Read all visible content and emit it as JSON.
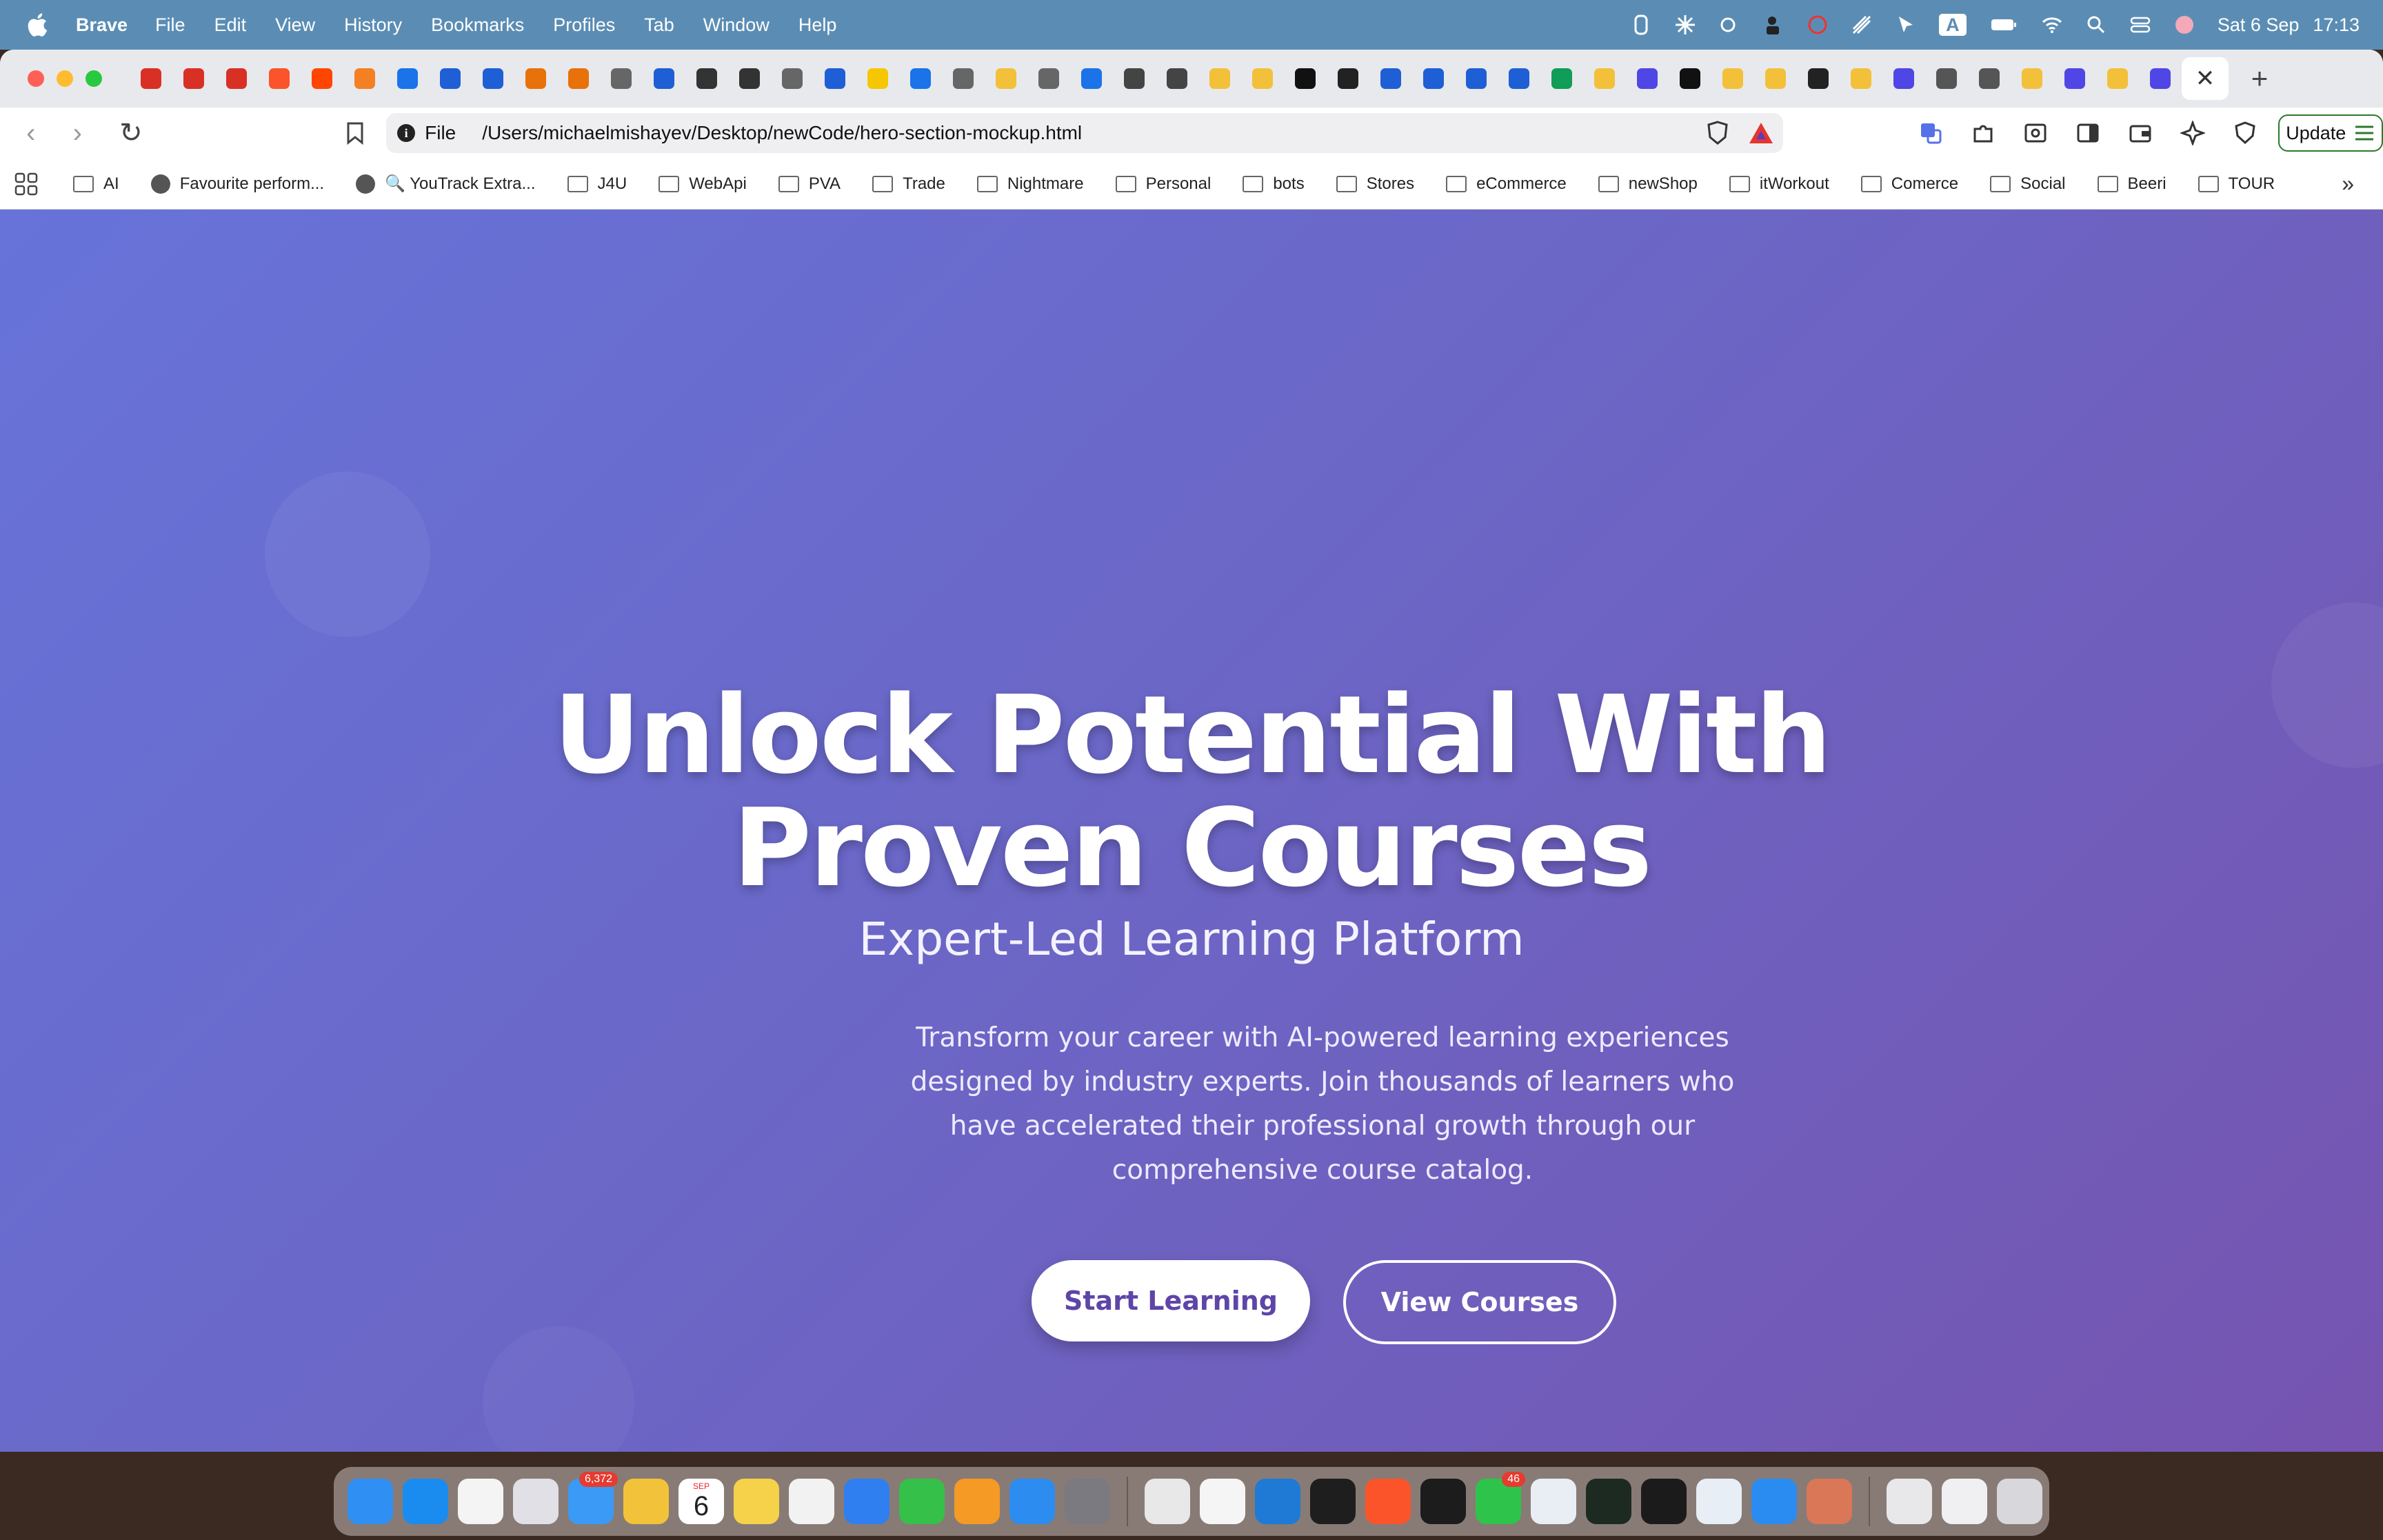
{
  "menubar": {
    "app_name": "Brave",
    "menus": [
      "File",
      "Edit",
      "View",
      "History",
      "Bookmarks",
      "Profiles",
      "Tab",
      "Window",
      "Help"
    ],
    "status_icons": [
      "figma-status-icon",
      "sparkle-status-icon",
      "weather-status-icon",
      "user-lock-icon",
      "blocked-icon",
      "stripes-icon",
      "cursor-icon",
      "input-source-icon",
      "battery-icon",
      "wifi-icon",
      "spotlight-search-icon",
      "control-center-icon",
      "profile-avatar-icon"
    ],
    "input_source": "A",
    "date": "Sat 6 Sep",
    "time": "17:13"
  },
  "tabs": {
    "favicons": [
      "#d93025",
      "#d93025",
      "#d93025",
      "#fb542b",
      "#ff4500",
      "#f48024",
      "#1a73e8",
      "#1f5fd6",
      "#1f5fd6",
      "#e8710a",
      "#e8710a",
      "#666666",
      "#1f5fd6",
      "#333333",
      "#333333",
      "#666666",
      "#1f5fd6",
      "#f6c700",
      "#1a73e8",
      "#666666",
      "#f3c03a",
      "#666666",
      "#1a73e8",
      "#444444",
      "#444444",
      "#f3c03a",
      "#f3c03a",
      "#111111",
      "#222222",
      "#1f5fd6",
      "#1f5fd6",
      "#1f5fd6",
      "#1f5fd6",
      "#0f9d58",
      "#f3c03a",
      "#4f46e5",
      "#111111",
      "#f3c03a",
      "#f3c03a",
      "#222222",
      "#f3c03a",
      "#4f46e5",
      "#555555",
      "#555555",
      "#f3c03a",
      "#4f46e5",
      "#f3c03a",
      "#4f46e5"
    ],
    "close_symbol": "✕",
    "new_tab_symbol": "+"
  },
  "toolbar": {
    "back": "‹",
    "forward": "›",
    "reload": "↻",
    "url_scheme": "File",
    "url": "/Users/michaelmishayev/Desktop/newCode/hero-section-mockup.html",
    "update_label": "Update"
  },
  "bookmarks": [
    {
      "label": "AI",
      "icon": "folder-icon"
    },
    {
      "label": "Favourite perform...",
      "icon": "globe-icon"
    },
    {
      "label": "🔍 YouTrack Extra...",
      "icon": "globe-icon"
    },
    {
      "label": "J4U",
      "icon": "folder-icon"
    },
    {
      "label": "WebApi",
      "icon": "folder-icon"
    },
    {
      "label": "PVA",
      "icon": "folder-icon"
    },
    {
      "label": "Trade",
      "icon": "folder-icon"
    },
    {
      "label": "Nightmare",
      "icon": "folder-icon"
    },
    {
      "label": "Personal",
      "icon": "folder-icon"
    },
    {
      "label": "bots",
      "icon": "folder-icon"
    },
    {
      "label": "Stores",
      "icon": "folder-icon"
    },
    {
      "label": "eCommerce",
      "icon": "folder-icon"
    },
    {
      "label": "newShop",
      "icon": "folder-icon"
    },
    {
      "label": "itWorkout",
      "icon": "folder-icon"
    },
    {
      "label": "Comerce",
      "icon": "folder-icon"
    },
    {
      "label": "Social",
      "icon": "folder-icon"
    },
    {
      "label": "Beeri",
      "icon": "folder-icon"
    },
    {
      "label": "TOUR",
      "icon": "folder-icon"
    }
  ],
  "bookmarks_more": "»",
  "hero": {
    "title_line1": "Unlock Potential With",
    "title_line2": "Proven Courses",
    "subtitle": "Expert-Led Learning Platform",
    "description": "Transform your career with AI-powered learning experiences designed by industry experts. Join thousands of learners who have accelerated their professional growth through our comprehensive course catalog.",
    "primary_button": "Start Learning",
    "secondary_button": "View Courses",
    "colors": {
      "gradient_start": "#6773d9",
      "gradient_end": "#7654b0",
      "primary_text": "#5e45a8"
    }
  },
  "dock": {
    "apps": [
      {
        "name": "finder-icon",
        "color": "#2f8ff3"
      },
      {
        "name": "safari-icon",
        "color": "#1a8cf0"
      },
      {
        "name": "reminders-icon",
        "color": "#f4f4f4"
      },
      {
        "name": "launchpad-icon",
        "color": "#e0e0e6"
      },
      {
        "name": "mail-icon",
        "color": "#3a9af5",
        "badge": "6,372"
      },
      {
        "name": "photos-icon",
        "color": "#f2c33a"
      },
      {
        "name": "calendar-icon",
        "color": "#ffffff",
        "month": "SEP",
        "day": "6"
      },
      {
        "name": "notes-icon",
        "color": "#f6d24a"
      },
      {
        "name": "freeform-icon",
        "color": "#f2f2f2"
      },
      {
        "name": "keynote-icon",
        "color": "#2f7ff0"
      },
      {
        "name": "numbers-icon",
        "color": "#35c04a"
      },
      {
        "name": "pages-icon",
        "color": "#f49a25"
      },
      {
        "name": "app-store-icon",
        "color": "#2d8cf0"
      },
      {
        "name": "system-settings-icon",
        "color": "#7a7a80"
      },
      {
        "name": "separator"
      },
      {
        "name": "chrome-icon",
        "color": "#e8e8e8"
      },
      {
        "name": "textedit-icon",
        "color": "#f5f5f5"
      },
      {
        "name": "vscode-icon",
        "color": "#1f7ad6"
      },
      {
        "name": "figma-icon",
        "color": "#1e1e1e"
      },
      {
        "name": "brave-icon",
        "color": "#fb542b"
      },
      {
        "name": "cursor-app-icon",
        "color": "#1c1c1c"
      },
      {
        "name": "whatsapp-icon",
        "color": "#2ec34a",
        "badge": "46"
      },
      {
        "name": "sourcetree-icon",
        "color": "#e9eef5"
      },
      {
        "name": "activity-monitor-icon",
        "color": "#1d2a22"
      },
      {
        "name": "terminal-icon",
        "color": "#1b1b1b"
      },
      {
        "name": "postgres-icon",
        "color": "#e8eef6"
      },
      {
        "name": "docker-icon",
        "color": "#2a8cf0"
      },
      {
        "name": "claude-icon",
        "color": "#d97757"
      },
      {
        "name": "separator"
      },
      {
        "name": "window-thumbnail-icon",
        "color": "#e8e8ea"
      },
      {
        "name": "window-thumbnail-icon",
        "color": "#f0f0f2"
      },
      {
        "name": "trash-icon",
        "color": "#d8d8dc"
      }
    ]
  }
}
